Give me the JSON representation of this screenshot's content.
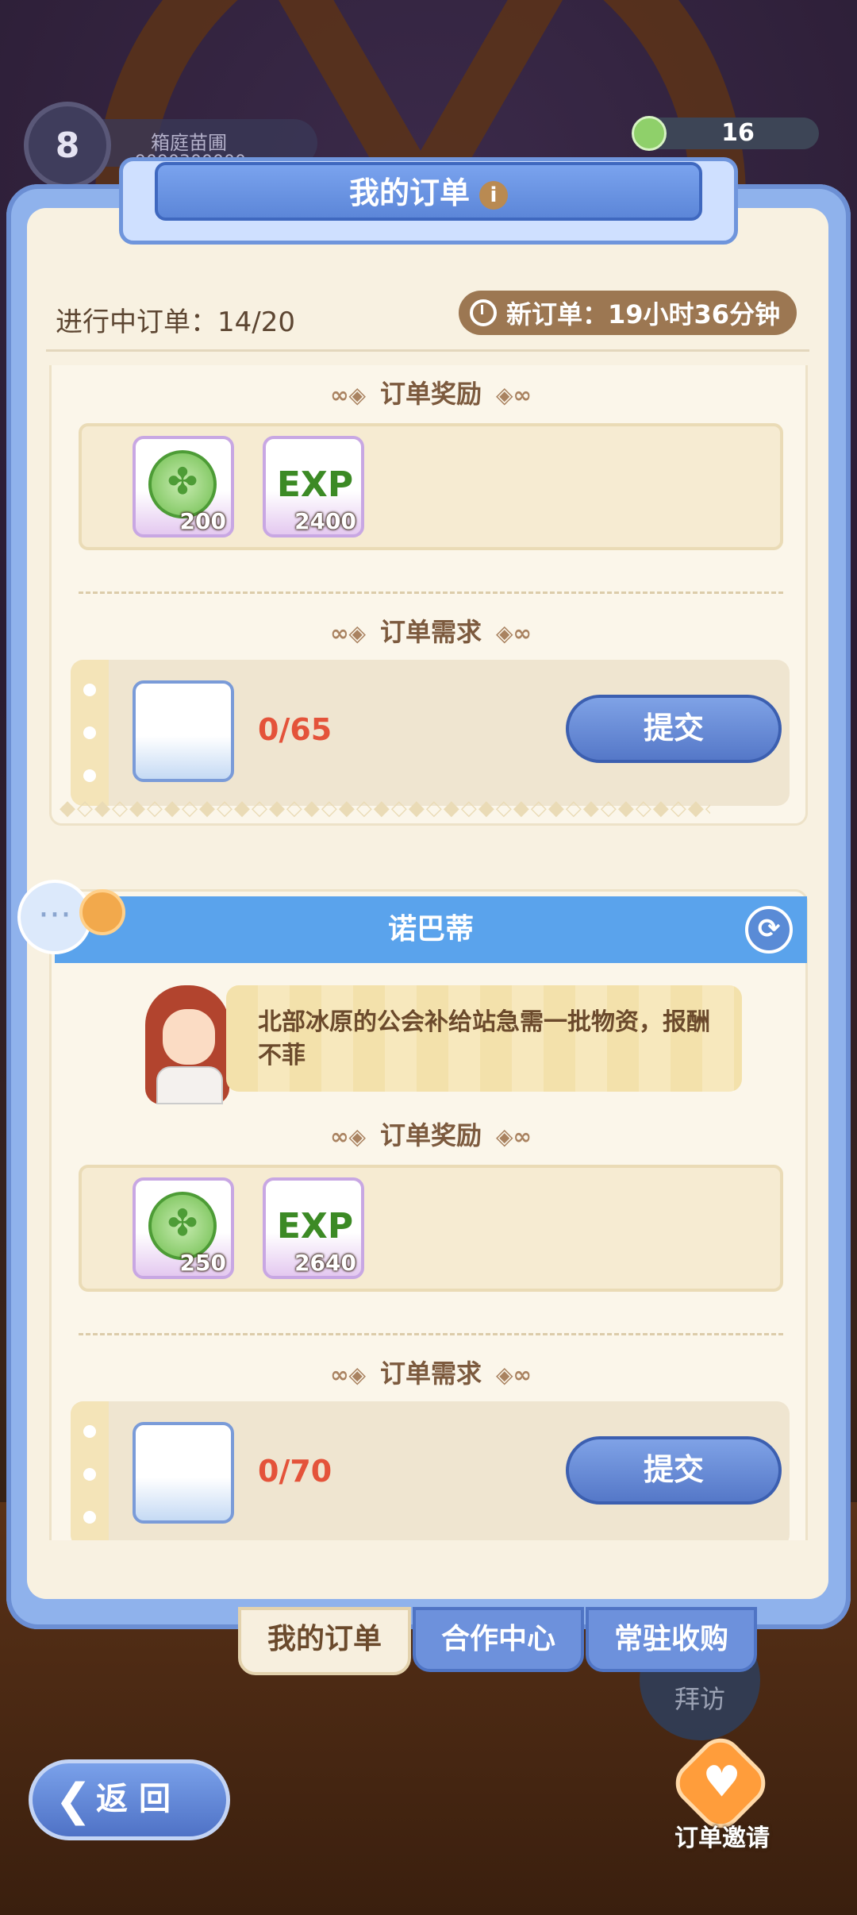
{
  "hud": {
    "level": "8",
    "player_name": "箱庭苗圃",
    "player_id": "9090300000",
    "coins": "16",
    "colors": {
      "accent_blue": "#5aa3ec",
      "progress_red": "#e4533a",
      "panel_cream": "#f8f1e1"
    }
  },
  "panel": {
    "title": "我的订单",
    "orders_in_progress": "进行中订单：14/20",
    "new_order_timer": "新订单：19小时36分钟"
  },
  "orders": [
    {
      "reward_header": "订单奖励",
      "rewards": [
        {
          "icon": "clover-coin-icon",
          "qty": "200"
        },
        {
          "icon": "exp-clover-icon",
          "label": "EXP",
          "qty": "2400"
        }
      ],
      "requirement_header": "订单需求",
      "requirement": {
        "icon": "salad-bowl-icon",
        "progress": "0/65"
      },
      "submit_label": "提交"
    },
    {
      "npc_name": "诺巴蒂",
      "message": "北部冰原的公会补给站急需一批物资，报酬不菲",
      "reward_header": "订单奖励",
      "rewards": [
        {
          "icon": "clover-coin-icon",
          "qty": "250"
        },
        {
          "icon": "exp-clover-icon",
          "label": "EXP",
          "qty": "2640"
        }
      ],
      "requirement_header": "订单需求",
      "requirement": {
        "icon": "radish-icon",
        "progress": "0/70"
      },
      "submit_label": "提交"
    }
  ],
  "tabs": [
    {
      "label": "我的订单",
      "active": true
    },
    {
      "label": "合作中心",
      "active": false
    },
    {
      "label": "常驻收购",
      "active": false
    }
  ],
  "bottom": {
    "visit_label": "拜访",
    "back_label": "返回",
    "invite_label": "订单邀请"
  }
}
